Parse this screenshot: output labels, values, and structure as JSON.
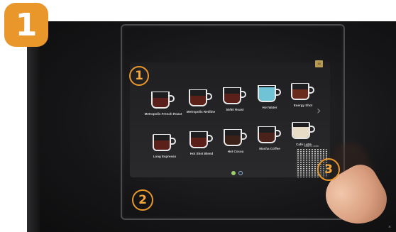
{
  "step_badge": "1",
  "screen": {
    "corner_tag": "16",
    "drinks": [
      {
        "label": "Metropolis French Roast",
        "fill": "#5a1f1a"
      },
      {
        "label": "Metropolis Redline",
        "fill": "#5d2018"
      },
      {
        "label": "50/50 Roast",
        "fill": "#5b2019"
      },
      {
        "label": "Hot Water",
        "fill": "#6fc3d4"
      },
      {
        "label": "Energy Shot",
        "fill": "#6a2a1c",
        "mark": "S"
      },
      {
        "label": "Long Espresso",
        "fill": "#5c201a"
      },
      {
        "label": "Hot Shot Blend",
        "fill": "#5a1f19",
        "mark": "S"
      },
      {
        "label": "Hot Cocoa",
        "fill": "#3c2118"
      },
      {
        "label": "Mocha Coffee",
        "fill": "#4a221a"
      },
      {
        "label": "Café Latte",
        "fill": "#e8dcc6"
      }
    ],
    "qr_caption": "Scan to order"
  },
  "callouts": {
    "one": "1",
    "two": "2",
    "three": "3"
  },
  "colors": {
    "accent": "#e9962b"
  }
}
